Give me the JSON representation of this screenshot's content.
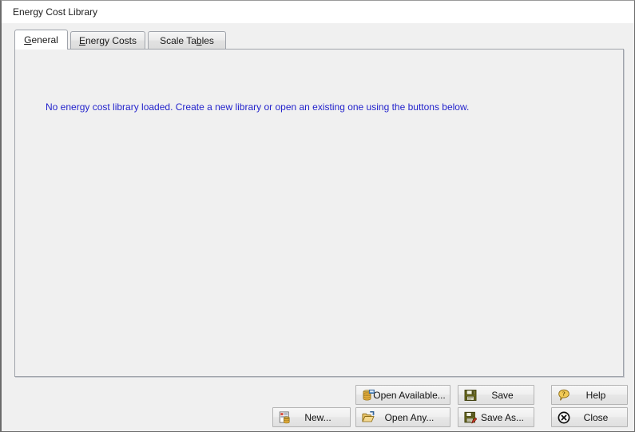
{
  "window": {
    "title": "Energy Cost Library"
  },
  "tabs": [
    {
      "name": "general",
      "label": "General",
      "accel": "G",
      "selected": true
    },
    {
      "name": "energy-costs",
      "label": "Energy Costs",
      "accel": "E",
      "selected": false
    },
    {
      "name": "scale-tables",
      "label": "Scale Tables",
      "accel": "b",
      "selected": false
    }
  ],
  "panel": {
    "message": "No energy cost library loaded. Create a new library or open an existing one using the buttons below."
  },
  "buttons": {
    "open_available": {
      "label": "Open Available...",
      "icon": "database-icon"
    },
    "save": {
      "label": "Save",
      "icon": "floppy-disk-icon"
    },
    "help": {
      "label": "Help",
      "icon": "help-balloon-icon"
    },
    "new": {
      "label": "New...",
      "icon": "new-document-database-icon"
    },
    "open_any": {
      "label": "Open Any...",
      "icon": "open-folder-icon"
    },
    "save_as": {
      "label": "Save As...",
      "icon": "floppy-disk-pencil-icon"
    },
    "close": {
      "label": "Close",
      "icon": "close-circle-icon"
    }
  },
  "colors": {
    "message_text": "#2323cc",
    "window_background": "#f0f0f0",
    "panel_background": "#f0f0f0",
    "titlebar_background": "#ffffff",
    "icon_gold": "#e8b64c",
    "icon_blue": "#4a7ebb",
    "icon_olive": "#6e6e1e"
  }
}
